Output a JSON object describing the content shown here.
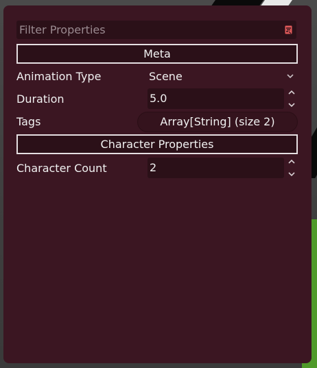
{
  "filter": {
    "placeholder": "Filter Properties",
    "value": ""
  },
  "sections": {
    "meta": {
      "label": "Meta"
    },
    "character": {
      "label": "Character Properties"
    }
  },
  "properties": {
    "animation_type": {
      "label": "Animation Type",
      "value": "Scene"
    },
    "duration": {
      "label": "Duration",
      "value": "5.0"
    },
    "tags": {
      "label": "Tags",
      "value": "Array[String] (size 2)"
    },
    "character_count": {
      "label": "Character Count",
      "value": "2"
    }
  },
  "icons": {
    "filter": "filter-icon",
    "dropdown": "chevron-down-icon",
    "spinner": "spinner-arrows-icon"
  },
  "colors": {
    "panel": "#3b1622",
    "field": "#2b1018",
    "border": "#e6dfe2",
    "accent_icon": "#e05a5a"
  }
}
